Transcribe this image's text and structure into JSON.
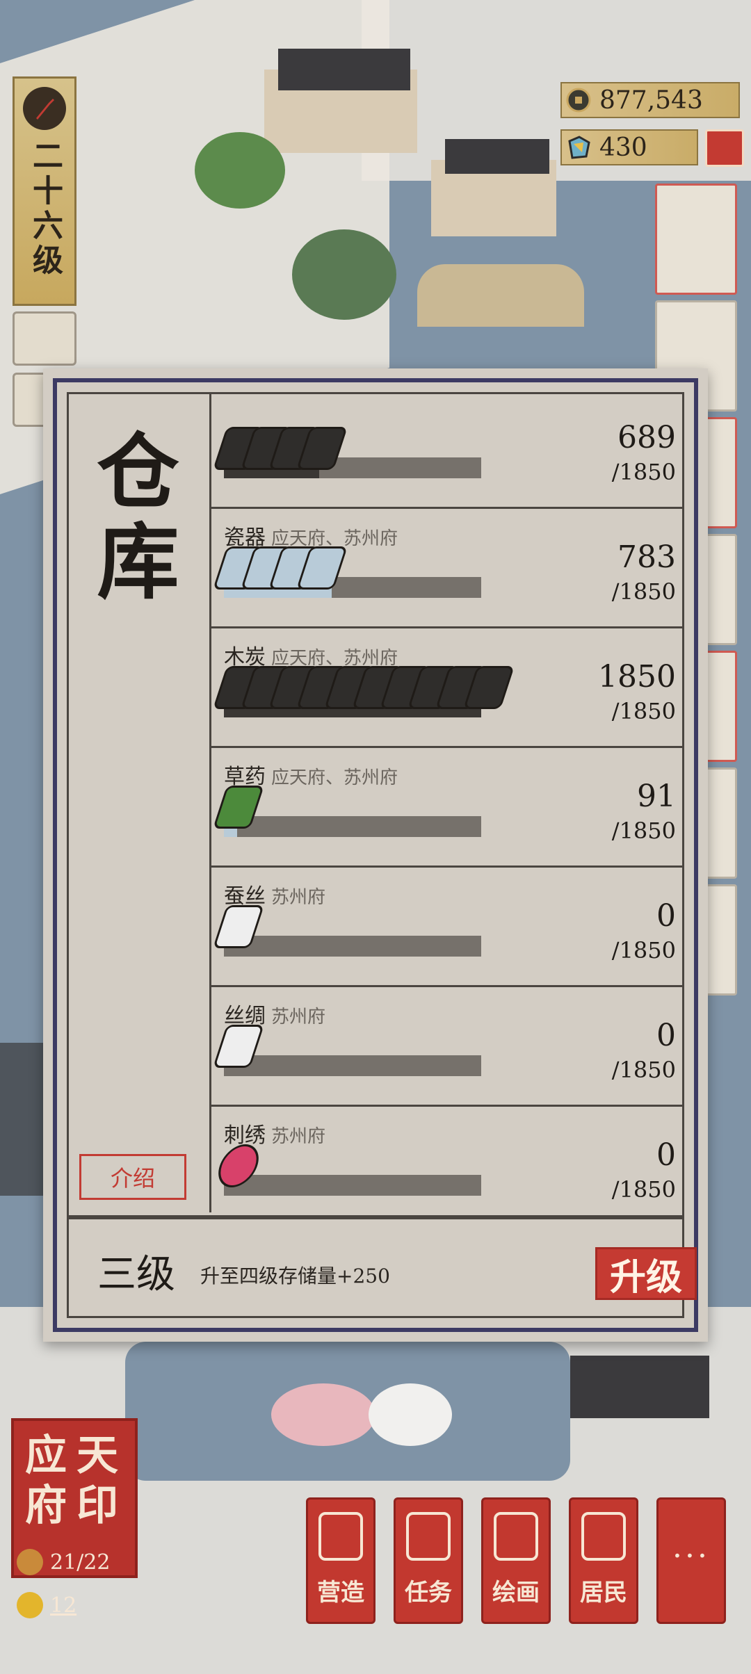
{
  "player": {
    "level_label": "二十六级"
  },
  "resources": {
    "coins": "877,543",
    "gems": "430"
  },
  "warehouse": {
    "title": "仓库",
    "intro_label": "介绍",
    "items": [
      {
        "name": "",
        "sources": "",
        "current": "689",
        "max": "/1850",
        "fill": 0.37,
        "icon": "ink-stick-icon",
        "color": "#2f2d2b"
      },
      {
        "name": "瓷器",
        "sources": "应天府、苏州府",
        "current": "783",
        "max": "/1850",
        "fill": 0.42,
        "icon": "porcelain-icon",
        "color": "#b8cbd8"
      },
      {
        "name": "木炭",
        "sources": "应天府、苏州府",
        "current": "1850",
        "max": "/1850",
        "fill": 1.0,
        "icon": "charcoal-icon",
        "color": "#2f2d2b"
      },
      {
        "name": "草药",
        "sources": "应天府、苏州府",
        "current": "91",
        "max": "/1850",
        "fill": 0.05,
        "icon": "herb-icon",
        "color": "#4c8a3b"
      },
      {
        "name": "蚕丝",
        "sources": "苏州府",
        "current": "0",
        "max": "/1850",
        "fill": 0.0,
        "icon": "silkworm-silk-icon",
        "color": "#eeeeee"
      },
      {
        "name": "丝绸",
        "sources": "苏州府",
        "current": "0",
        "max": "/1850",
        "fill": 0.0,
        "icon": "silk-cloth-icon",
        "color": "#eeeeee"
      },
      {
        "name": "刺绣",
        "sources": "苏州府",
        "current": "0",
        "max": "/1850",
        "fill": 0.0,
        "icon": "embroidery-icon",
        "color": "#d8416a"
      }
    ],
    "level": "三级",
    "upgrade_hint": "升至四级存储量+250",
    "upgrade_label": "升级"
  },
  "seal": {
    "chars": [
      "应",
      "天",
      "府",
      "印"
    ],
    "population": "21/22",
    "count": "12"
  },
  "nav": {
    "build": "营造",
    "tasks": "任务",
    "paint": "绘画",
    "residents": "居民",
    "more": "···"
  }
}
